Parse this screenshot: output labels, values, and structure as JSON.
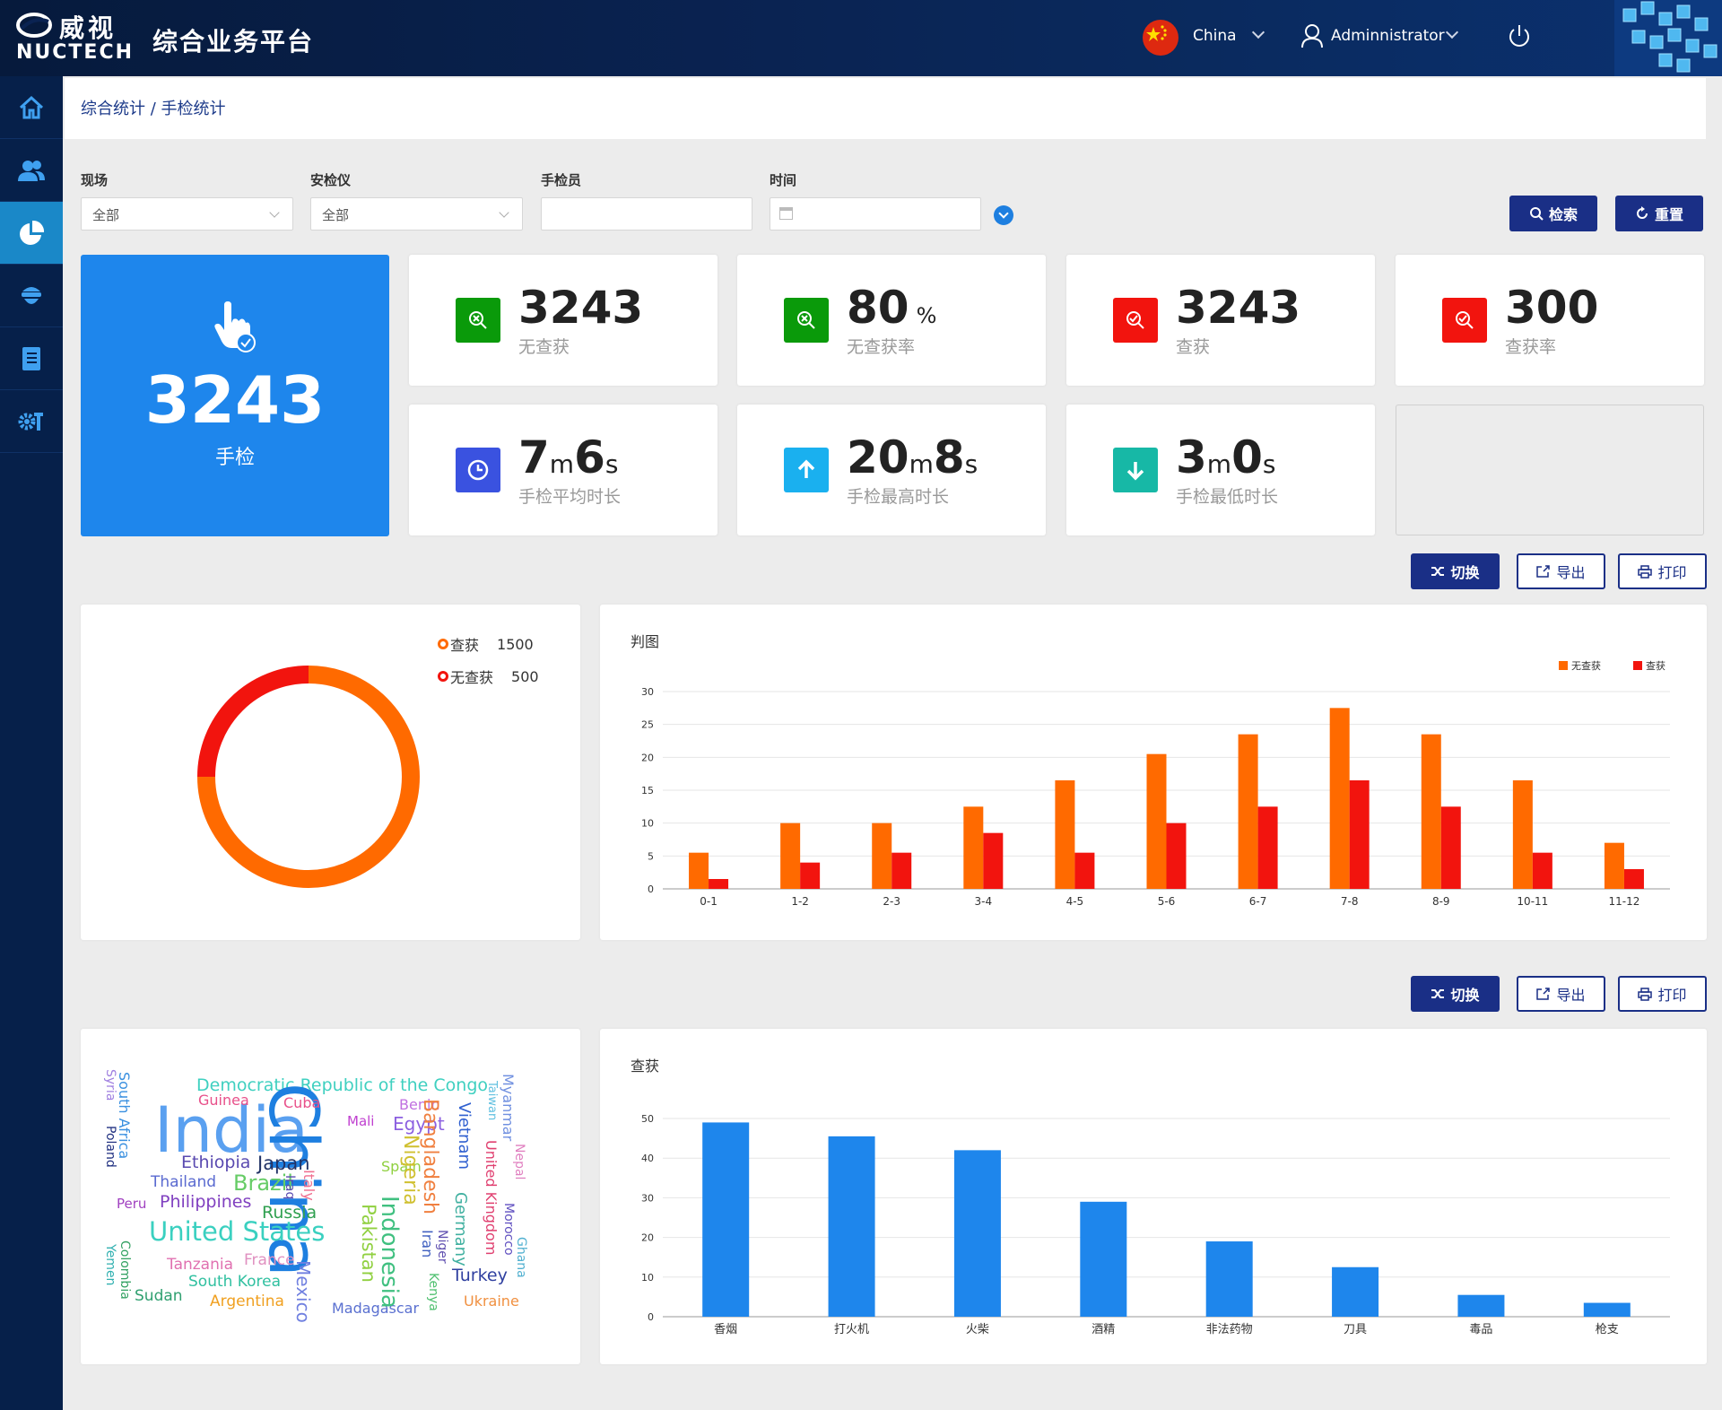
{
  "header": {
    "logo_zh": "威视",
    "logo_en": "NUCTECH",
    "app_title": "综合业务平台",
    "country": "China",
    "user": "Adminnistrator"
  },
  "breadcrumb": "综合统计 / 手检统计",
  "filters": {
    "site_label": "现场",
    "site_value": "全部",
    "device_label": "安检仪",
    "device_value": "全部",
    "inspector_label": "手检员",
    "inspector_value": "",
    "time_label": "时间",
    "time_value": ""
  },
  "buttons": {
    "search": "检索",
    "reset": "重置",
    "switch": "切换",
    "export": "导出",
    "print": "打印"
  },
  "stats": {
    "total": {
      "value": "3243",
      "label": "手检"
    },
    "no_seizure": {
      "value": "3243",
      "label": "无查获"
    },
    "no_seizure_rate": {
      "value": "80",
      "unit": "%",
      "label": "无查获率"
    },
    "seizure": {
      "value": "3243",
      "label": "查获"
    },
    "seizure_rate": {
      "value": "300",
      "label": "查获率"
    },
    "avg": {
      "m": "7",
      "m_unit": "m",
      "s": "6",
      "s_unit": "s",
      "label": "手检平均时长"
    },
    "max": {
      "m": "20",
      "m_unit": "m",
      "s": "8",
      "s_unit": "s",
      "label": "手检最高时长"
    },
    "min": {
      "m": "3",
      "m_unit": "m",
      "s": "0",
      "s_unit": "s",
      "label": "手检最低时长"
    }
  },
  "donut": {
    "legend": [
      {
        "name": "查获",
        "value": "1500",
        "color": "#ff6a00"
      },
      {
        "name": "无查获",
        "value": "500",
        "color": "#f2140e"
      }
    ]
  },
  "colors": {
    "orange": "#ff6a00",
    "red": "#f2140e",
    "blue": "#1e86ec",
    "navy": "#1a2f86"
  },
  "chart_data": [
    {
      "type": "bar",
      "title": "判图",
      "categories": [
        "0-1",
        "1-2",
        "2-3",
        "3-4",
        "4-5",
        "5-6",
        "6-7",
        "7-8",
        "8-9",
        "10-11",
        "11-12"
      ],
      "series": [
        {
          "name": "无查获",
          "values": [
            5.5,
            10,
            10,
            12.5,
            16.5,
            20.5,
            23.5,
            27.5,
            23.5,
            16.5,
            7
          ],
          "color": "#ff6a00"
        },
        {
          "name": "查获",
          "values": [
            1.5,
            4,
            5.5,
            8.5,
            5.5,
            10,
            12.5,
            16.5,
            12.5,
            5.5,
            3
          ],
          "color": "#f2140e"
        }
      ],
      "yticks": [
        0,
        5,
        10,
        15,
        20,
        25,
        30
      ],
      "ylim": [
        0,
        30
      ]
    },
    {
      "type": "bar",
      "title": "查获",
      "categories": [
        "香烟",
        "打火机",
        "火柴",
        "酒精",
        "非法药物",
        "刀具",
        "毒品",
        "枪支"
      ],
      "values": [
        49,
        45.5,
        42,
        29,
        19,
        12.5,
        5.5,
        3.5
      ],
      "color": "#1e86ec",
      "yticks": [
        0,
        10,
        20,
        30,
        40,
        50
      ],
      "ylim": [
        0,
        50
      ]
    }
  ],
  "wordcloud": [
    {
      "t": "Democratic Republic of the Congo",
      "c": "#3fd0c0"
    },
    {
      "t": "India",
      "c": "#5aa0f0"
    },
    {
      "t": "China",
      "c": "#1e7fe0"
    },
    {
      "t": "Guinea",
      "c": "#e8508a"
    },
    {
      "t": "Cuba",
      "c": "#e8508a"
    },
    {
      "t": "Benin",
      "c": "#c070e0"
    },
    {
      "t": "Mali",
      "c": "#c040d0"
    },
    {
      "t": "Egypt",
      "c": "#8c60e0"
    },
    {
      "t": "Syria",
      "c": "#a080e0"
    },
    {
      "t": "South Africa",
      "c": "#3a90e0"
    },
    {
      "t": "Poland",
      "c": "#203080"
    },
    {
      "t": "Ethiopia",
      "c": "#5a4ab0"
    },
    {
      "t": "Japan",
      "c": "#223366"
    },
    {
      "t": "Thailand",
      "c": "#5a6ad0"
    },
    {
      "t": "Brazil",
      "c": "#66cc66"
    },
    {
      "t": "Iraq",
      "c": "#5a4ab0"
    },
    {
      "t": "Italy",
      "c": "#f07090"
    },
    {
      "t": "Spain",
      "c": "#90d040"
    },
    {
      "t": "Nigeria",
      "c": "#d0c030"
    },
    {
      "t": "Bangladesh",
      "c": "#f08040"
    },
    {
      "t": "Vietnam",
      "c": "#3060d0"
    },
    {
      "t": "Taiwan",
      "c": "#60c0e0"
    },
    {
      "t": "Myanmar",
      "c": "#7090e0"
    },
    {
      "t": "Nepal",
      "c": "#e080c0"
    },
    {
      "t": "United Kingdom",
      "c": "#e04070"
    },
    {
      "t": "Morocco",
      "c": "#6050c0"
    },
    {
      "t": "Ghana",
      "c": "#50b0d0"
    },
    {
      "t": "Peru",
      "c": "#a040c0"
    },
    {
      "t": "Philippines",
      "c": "#8040c0"
    },
    {
      "t": "Russia",
      "c": "#30a050"
    },
    {
      "t": "United States",
      "c": "#3ad0c0"
    },
    {
      "t": "Yemen",
      "c": "#30b0b0"
    },
    {
      "t": "Colombia",
      "c": "#30a060"
    },
    {
      "t": "Tanzania",
      "c": "#e070b0"
    },
    {
      "t": "France",
      "c": "#e090c0"
    },
    {
      "t": "South Korea",
      "c": "#30c0a0"
    },
    {
      "t": "Sudan",
      "c": "#30a070"
    },
    {
      "t": "Argentina",
      "c": "#f0a020"
    },
    {
      "t": "Mexico",
      "c": "#7080e0"
    },
    {
      "t": "Madagascar",
      "c": "#5a70d0"
    },
    {
      "t": "Pakistan",
      "c": "#90d040"
    },
    {
      "t": "Indonesia",
      "c": "#40c080"
    },
    {
      "t": "Iran",
      "c": "#4060c0"
    },
    {
      "t": "Niger",
      "c": "#6050b0"
    },
    {
      "t": "Kenya",
      "c": "#50c070"
    },
    {
      "t": "Germany",
      "c": "#40b0a0"
    },
    {
      "t": "Turkey",
      "c": "#3040a0"
    },
    {
      "t": "Ukraine",
      "c": "#f09040"
    }
  ]
}
